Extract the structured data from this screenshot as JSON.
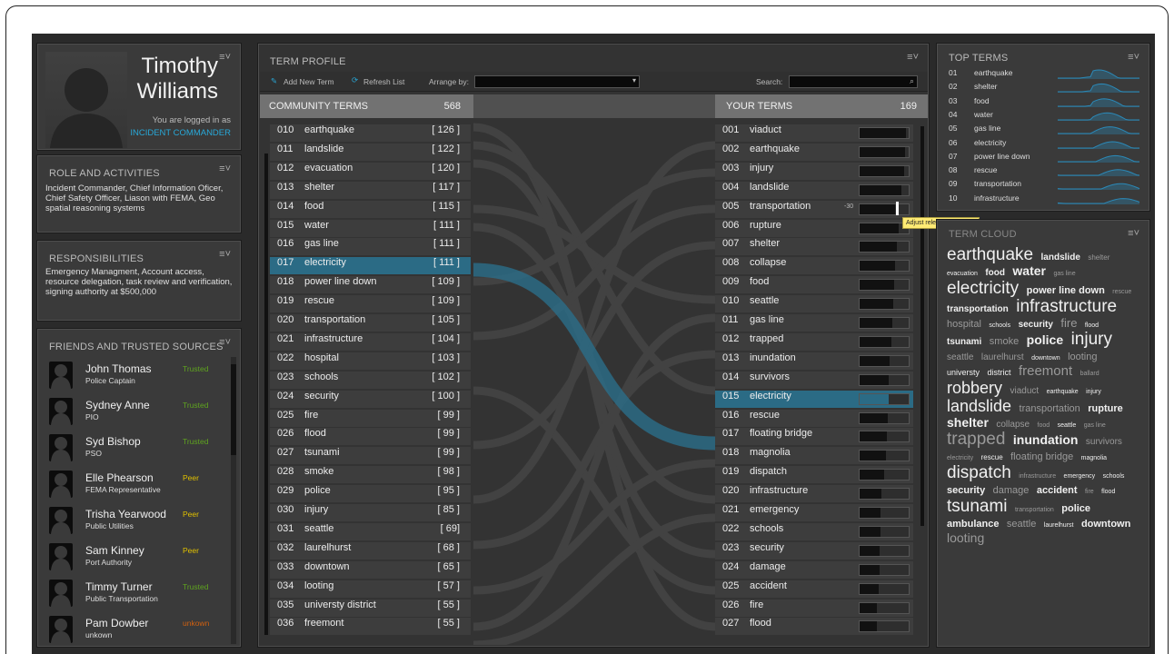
{
  "profile": {
    "first": "Timothy",
    "last": "Williams",
    "logged": "You are logged in as",
    "role": "INCIDENT COMMANDER"
  },
  "roles": {
    "title": "ROLE AND ACTIVITIES",
    "text": "Incident Commander, Chief Information Oficer, Chief Safety Officer, Liason with FEMA, Geo spatial reasoning systems"
  },
  "resp": {
    "title": "RESPONSIBILITIES",
    "text": "Emergency Managment, Account access, resource delegation, task review and verification, signing authority at $500,000"
  },
  "friends": {
    "title": "FRIENDS AND TRUSTED SOURCES",
    "items": [
      {
        "name": "John Thomas",
        "role": "Police Captain",
        "status": "Trusted"
      },
      {
        "name": "Sydney Anne",
        "role": "PIO",
        "status": "Trusted"
      },
      {
        "name": "Syd Bishop",
        "role": "PSO",
        "status": "Trusted"
      },
      {
        "name": "Elle Phearson",
        "role": "FEMA Representative",
        "status": "Peer"
      },
      {
        "name": "Trisha Yearwood",
        "role": "Public Utilities",
        "status": "Peer"
      },
      {
        "name": "Sam Kinney",
        "role": "Port Authority",
        "status": "Peer"
      },
      {
        "name": "Timmy Turner",
        "role": "Public Transportation",
        "status": "Trusted"
      },
      {
        "name": "Pam Dowber",
        "role": "unkown",
        "status": "unkown"
      }
    ]
  },
  "colors": {
    "trusted": "#5fa31f",
    "peer": "#e0c000",
    "unknown": "#d06010",
    "highlight": "#2b6b85",
    "accent": "#28a8d8"
  },
  "termprofile": {
    "title": "TERM PROFILE",
    "add": "Add New Term",
    "refresh": "Refresh List",
    "arrange": "Arrange by:",
    "search": "Search:",
    "community_label": "COMMUNITY TERMS",
    "community_count": "568",
    "your_label": "YOUR TERMS",
    "your_count": "169",
    "tooltip": "Adjust relevance ranking",
    "adjust_value": "-30",
    "community": [
      {
        "n": "010",
        "t": "earthquake",
        "c": "[ 126 ]"
      },
      {
        "n": "011",
        "t": "landslide",
        "c": "[ 122 ]"
      },
      {
        "n": "012",
        "t": "evacuation",
        "c": "[ 120 ]"
      },
      {
        "n": "013",
        "t": "shelter",
        "c": "[ 117 ]"
      },
      {
        "n": "014",
        "t": "food",
        "c": "[ 115 ]"
      },
      {
        "n": "015",
        "t": "water",
        "c": "[ 111 ]"
      },
      {
        "n": "016",
        "t": "gas line",
        "c": "[ 111 ]"
      },
      {
        "n": "017",
        "t": "electricity",
        "c": "[ 111 ]"
      },
      {
        "n": "018",
        "t": "power line down",
        "c": "[ 109 ]"
      },
      {
        "n": "019",
        "t": "rescue",
        "c": "[ 109 ]"
      },
      {
        "n": "020",
        "t": "transportation",
        "c": "[ 105 ]"
      },
      {
        "n": "021",
        "t": "infrastructure",
        "c": "[ 104 ]"
      },
      {
        "n": "022",
        "t": "hospital",
        "c": "[ 103 ]"
      },
      {
        "n": "023",
        "t": "schools",
        "c": "[ 102 ]"
      },
      {
        "n": "024",
        "t": "security",
        "c": "[ 100 ]"
      },
      {
        "n": "025",
        "t": "fire",
        "c": "[ 99 ]"
      },
      {
        "n": "026",
        "t": "flood",
        "c": "[ 99 ]"
      },
      {
        "n": "027",
        "t": "tsunami",
        "c": "[ 99 ]"
      },
      {
        "n": "028",
        "t": "smoke",
        "c": "[ 98 ]"
      },
      {
        "n": "029",
        "t": "police",
        "c": "[ 95 ]"
      },
      {
        "n": "030",
        "t": "injury",
        "c": "[ 85 ]"
      },
      {
        "n": "031",
        "t": "seattle",
        "c": "[ 69]"
      },
      {
        "n": "032",
        "t": "laurelhurst",
        "c": "[ 68 ]"
      },
      {
        "n": "033",
        "t": "downtown",
        "c": "[ 65 ]"
      },
      {
        "n": "034",
        "t": "looting",
        "c": "[ 57 ]"
      },
      {
        "n": "035",
        "t": "universty district",
        "c": "[ 55 ]"
      },
      {
        "n": "036",
        "t": "freemont",
        "c": "[ 55 ]"
      }
    ],
    "yours": [
      {
        "n": "001",
        "t": "viaduct",
        "r": 0.95
      },
      {
        "n": "002",
        "t": "earthquake",
        "r": 0.92
      },
      {
        "n": "003",
        "t": "injury",
        "r": 0.9
      },
      {
        "n": "004",
        "t": "landslide",
        "r": 0.86
      },
      {
        "n": "005",
        "t": "transportation",
        "r": 0.72
      },
      {
        "n": "006",
        "t": "rupture",
        "r": 0.8
      },
      {
        "n": "007",
        "t": "shelter",
        "r": 0.75
      },
      {
        "n": "008",
        "t": "collapse",
        "r": 0.72
      },
      {
        "n": "009",
        "t": "food",
        "r": 0.7
      },
      {
        "n": "010",
        "t": "seattle",
        "r": 0.68
      },
      {
        "n": "011",
        "t": "gas line",
        "r": 0.66
      },
      {
        "n": "012",
        "t": "trapped",
        "r": 0.64
      },
      {
        "n": "013",
        "t": "inundation",
        "r": 0.62
      },
      {
        "n": "014",
        "t": "survivors",
        "r": 0.6
      },
      {
        "n": "015",
        "t": "electricity",
        "r": 0.6
      },
      {
        "n": "016",
        "t": "rescue",
        "r": 0.58
      },
      {
        "n": "017",
        "t": "floating bridge",
        "r": 0.56
      },
      {
        "n": "018",
        "t": "magnolia",
        "r": 0.54
      },
      {
        "n": "019",
        "t": "dispatch",
        "r": 0.5
      },
      {
        "n": "020",
        "t": "infrastructure",
        "r": 0.45
      },
      {
        "n": "021",
        "t": "emergency",
        "r": 0.42
      },
      {
        "n": "022",
        "t": "schools",
        "r": 0.42
      },
      {
        "n": "023",
        "t": "security",
        "r": 0.4
      },
      {
        "n": "024",
        "t": "damage",
        "r": 0.4
      },
      {
        "n": "025",
        "t": "accident",
        "r": 0.38
      },
      {
        "n": "026",
        "t": "fire",
        "r": 0.36
      },
      {
        "n": "027",
        "t": "flood",
        "r": 0.36
      }
    ]
  },
  "topterms": {
    "title": "TOP TERMS",
    "items": [
      {
        "n": "01",
        "t": "earthquake"
      },
      {
        "n": "02",
        "t": "shelter"
      },
      {
        "n": "03",
        "t": "food"
      },
      {
        "n": "04",
        "t": "water"
      },
      {
        "n": "05",
        "t": "gas line"
      },
      {
        "n": "06",
        "t": "electricity"
      },
      {
        "n": "07",
        "t": "power line down"
      },
      {
        "n": "08",
        "t": "rescue"
      },
      {
        "n": "09",
        "t": "transportation"
      },
      {
        "n": "10",
        "t": "infrastructure"
      }
    ]
  },
  "cloud": {
    "title": "TERM CLOUD",
    "words": [
      [
        "earthquake",
        19,
        0
      ],
      [
        "landslide",
        10,
        0
      ],
      [
        "shelter",
        8,
        1
      ],
      [
        "evacuation",
        7,
        0
      ],
      [
        "food",
        10,
        0
      ],
      [
        "water",
        14,
        0
      ],
      [
        "gas line",
        7,
        1
      ],
      [
        "electricity",
        19,
        0
      ],
      [
        "power line down",
        11,
        0
      ],
      [
        "rescue",
        7,
        1
      ],
      [
        "transportation",
        10,
        0
      ],
      [
        "infrastructure",
        19,
        0
      ],
      [
        "hospital",
        11,
        1
      ],
      [
        "schools",
        7,
        0
      ],
      [
        "security",
        10,
        0
      ],
      [
        "fire",
        13,
        1
      ],
      [
        "flood",
        7,
        0
      ],
      [
        "tsunami",
        10,
        0
      ],
      [
        "smoke",
        11,
        1
      ],
      [
        "police",
        14,
        0
      ],
      [
        "injury",
        19,
        0
      ],
      [
        "seattle",
        10,
        1
      ],
      [
        "laurelhurst",
        10,
        1
      ],
      [
        "downtown",
        7,
        0
      ],
      [
        "looting",
        11,
        1
      ],
      [
        "universty",
        9,
        0
      ],
      [
        "district",
        9,
        0
      ],
      [
        "freemont",
        15,
        1
      ],
      [
        "ballard",
        7,
        1
      ],
      [
        "robbery",
        18,
        0
      ],
      [
        "viaduct",
        10,
        1
      ],
      [
        "earthquake",
        7,
        0
      ],
      [
        "injury",
        7,
        0
      ],
      [
        "landslide",
        18,
        0
      ],
      [
        "transportation",
        11,
        1
      ],
      [
        "rupture",
        11,
        0
      ],
      [
        "shelter",
        14,
        0
      ],
      [
        "collapse",
        10,
        1
      ],
      [
        "food",
        7,
        1
      ],
      [
        "seattle",
        7,
        0
      ],
      [
        "gas line",
        7,
        1
      ],
      [
        "trapped",
        19,
        1
      ],
      [
        "inundation",
        14,
        0
      ],
      [
        "survivors",
        10,
        1
      ],
      [
        "electricity",
        7,
        1
      ],
      [
        "rescue",
        8,
        0
      ],
      [
        "floating bridge",
        11,
        1
      ],
      [
        "magnolia",
        7,
        0
      ],
      [
        "dispatch",
        19,
        0
      ],
      [
        "infrastructure",
        7,
        1
      ],
      [
        "emergency",
        7,
        0
      ],
      [
        "schools",
        7,
        0
      ],
      [
        "security",
        11,
        0
      ],
      [
        "damage",
        11,
        1
      ],
      [
        "accident",
        11,
        0
      ],
      [
        "fire",
        7,
        1
      ],
      [
        "flood",
        7,
        0
      ],
      [
        "tsunami",
        19,
        0
      ],
      [
        "transportation",
        7,
        1
      ],
      [
        "police",
        11,
        0
      ],
      [
        "ambulance",
        11,
        0
      ],
      [
        "seattle",
        11,
        1
      ],
      [
        "laurelhurst",
        7,
        0
      ],
      [
        "downtown",
        11,
        0
      ],
      [
        "looting",
        14,
        1
      ]
    ]
  }
}
